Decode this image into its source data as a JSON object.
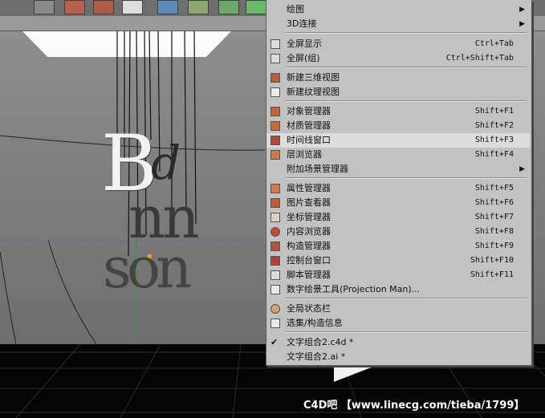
{
  "menu": {
    "items": [
      {
        "label": "绘图",
        "shortcut": "",
        "submenu": true,
        "icon": "none"
      },
      {
        "label": "3D连接",
        "shortcut": "",
        "submenu": true,
        "icon": "none"
      },
      {
        "label": "全屏显示",
        "shortcut": "Ctrl+Tab",
        "submenu": false,
        "icon": "fullscreen-icon"
      },
      {
        "label": "全屏(组)",
        "shortcut": "Ctrl+Shift+Tab",
        "submenu": false,
        "icon": "fullscreen-group-icon"
      },
      {
        "label": "新建三维视图",
        "shortcut": "",
        "submenu": false,
        "icon": "new-3d-view-icon"
      },
      {
        "label": "新建纹理视图",
        "shortcut": "",
        "submenu": false,
        "icon": "new-texture-view-icon"
      },
      {
        "label": "对象管理器",
        "shortcut": "Shift+F1",
        "submenu": false,
        "icon": "object-manager-icon"
      },
      {
        "label": "材质管理器",
        "shortcut": "Shift+F2",
        "submenu": false,
        "icon": "material-manager-icon"
      },
      {
        "label": "时间线窗口",
        "shortcut": "Shift+F3",
        "submenu": false,
        "icon": "timeline-icon",
        "highlighted": true
      },
      {
        "label": "层浏览器",
        "shortcut": "Shift+F4",
        "submenu": false,
        "icon": "layer-browser-icon"
      },
      {
        "label": "附加场景管理器",
        "shortcut": "",
        "submenu": true,
        "icon": "none"
      },
      {
        "label": "属性管理器",
        "shortcut": "Shift+F5",
        "submenu": false,
        "icon": "attribute-manager-icon"
      },
      {
        "label": "图片查看器",
        "shortcut": "Shift+F6",
        "submenu": false,
        "icon": "picture-viewer-icon"
      },
      {
        "label": "坐标管理器",
        "shortcut": "Shift+F7",
        "submenu": false,
        "icon": "coordinate-manager-icon"
      },
      {
        "label": "内容浏览器",
        "shortcut": "Shift+F8",
        "submenu": false,
        "icon": "content-browser-icon"
      },
      {
        "label": "构造管理器",
        "shortcut": "Shift+F9",
        "submenu": false,
        "icon": "structure-manager-icon"
      },
      {
        "label": "控制台窗口",
        "shortcut": "Shift+F10",
        "submenu": false,
        "icon": "console-icon"
      },
      {
        "label": "脚本管理器",
        "shortcut": "Shift+F11",
        "submenu": false,
        "icon": "script-manager-icon"
      },
      {
        "label": "数字绘景工具(Projection Man)...",
        "shortcut": "",
        "submenu": false,
        "icon": "projection-man-icon"
      },
      {
        "label": "全局状态栏",
        "shortcut": "",
        "submenu": false,
        "icon": "global-status-icon"
      },
      {
        "label": "选集/构造信息",
        "shortcut": "",
        "submenu": false,
        "icon": "selection-info-icon"
      },
      {
        "label": "文字组合2.c4d *",
        "shortcut": "",
        "submenu": false,
        "icon": "none",
        "checked": true
      },
      {
        "label": "文字组合2.ai *",
        "shortcut": "",
        "submenu": false,
        "icon": "none"
      }
    ],
    "accent_highlight": "#dcdcdc"
  },
  "scene": {
    "letters_row1": "B",
    "letters_row1b": "d",
    "letters_row2": "nn",
    "letters_row3": "SON"
  },
  "watermark": "C4D吧 【www.linecg.com/tieba/1799】"
}
